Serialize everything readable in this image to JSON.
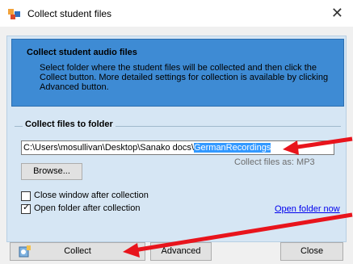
{
  "window": {
    "title": "Collect student files",
    "close_glyph": "✕"
  },
  "header": {
    "title": "Collect student audio files",
    "description": "Select folder where the student files will be collected and then click the Collect button. More detailed settings for collection is available by clicking Advanced button."
  },
  "collect_group": {
    "title": "Collect files to folder",
    "path_prefix": "C:\\Users\\mosullivan\\Desktop\\Sanako docs\\",
    "path_selected": "GermanRecordings",
    "browse_label": "Browse...",
    "collect_as": "Collect files as: MP3"
  },
  "options": {
    "close_after_label": "Close window after collection",
    "close_after_checked": false,
    "open_after_label": "Open folder after collection",
    "open_after_checked": true,
    "open_folder_link": "Open folder now"
  },
  "buttons": {
    "collect": "Collect",
    "advanced": "Advanced",
    "close": "Close"
  },
  "colors": {
    "header_bg": "#3e8bd4",
    "panel_bg": "#d6e6f4",
    "annotation_arrow": "#e8141c"
  },
  "icons": [
    "app-icon",
    "collect-icon",
    "close-icon",
    "checkmark-icon"
  ]
}
